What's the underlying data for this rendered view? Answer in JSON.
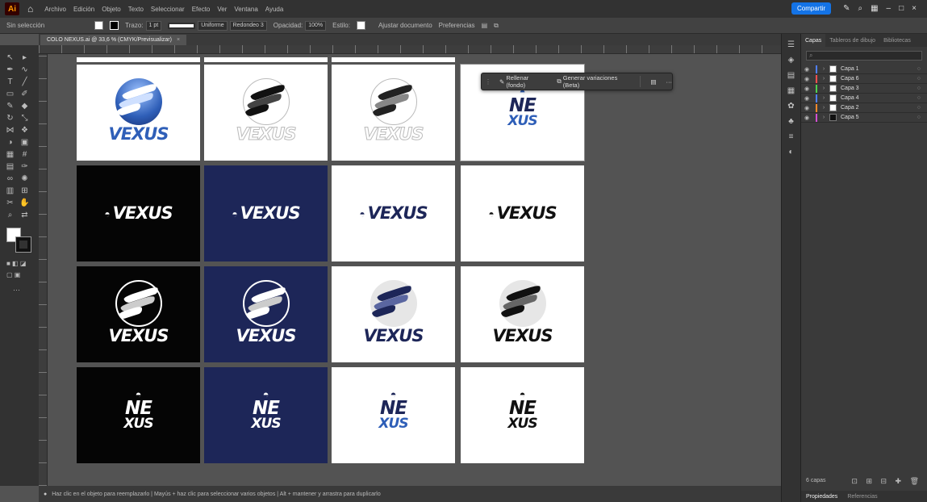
{
  "app": {
    "logo": "Ai",
    "menu": [
      "Archivo",
      "Edición",
      "Objeto",
      "Texto",
      "Seleccionar",
      "Efecto",
      "Ver",
      "Ventana",
      "Ayuda"
    ],
    "share_label": "Compartir"
  },
  "control_bar": {
    "selection_label": "Sin selección",
    "stroke_label": "Trazo:",
    "stroke_value": "1 pt",
    "profile_value": "Uniforme",
    "brush_value": "Redondeo 3",
    "opacity_label": "Opacidad:",
    "opacity_value": "100%",
    "style_label": "Estilo:",
    "doc_setup": "Ajustar documento",
    "preferences": "Preferencias"
  },
  "document": {
    "tab_title": "COLO NEXUS.ai @ 33,6 % (CMYK/Previsualizar)"
  },
  "context_bar": {
    "items": [
      "Rellenar (fondo)",
      "Generar variaciones (Beta)"
    ]
  },
  "status": {
    "text": "Haz clic en el objeto para reemplazarlo  |  Mayús + haz clic para seleccionar varios objetos  |  Alt + mantener y arrastra para duplicarlo"
  },
  "layers_panel": {
    "tabs": [
      "Capas",
      "Tableros de dibujo",
      "Bibliotecas"
    ],
    "layers": [
      {
        "name": "Capa 1",
        "color": "#4f7fff"
      },
      {
        "name": "Capa 6",
        "color": "#ff4f4f"
      },
      {
        "name": "Capa 3",
        "color": "#4fd24f"
      },
      {
        "name": "Capa 4",
        "color": "#4f7fff"
      },
      {
        "name": "Capa 2",
        "color": "#ff8a2a"
      },
      {
        "name": "Capa 5",
        "color": "#d24fd2"
      }
    ],
    "footer_label": "6 capas",
    "bottom_tabs": [
      "Propiedades",
      "Referencias"
    ]
  },
  "artwork": {
    "wordmark": "VEXUS",
    "stacked_line1": "NE",
    "stacked_line2": "XUS",
    "colors": {
      "navy": "#1d2658",
      "black": "#050505",
      "blue": "#2f5fb8"
    }
  }
}
